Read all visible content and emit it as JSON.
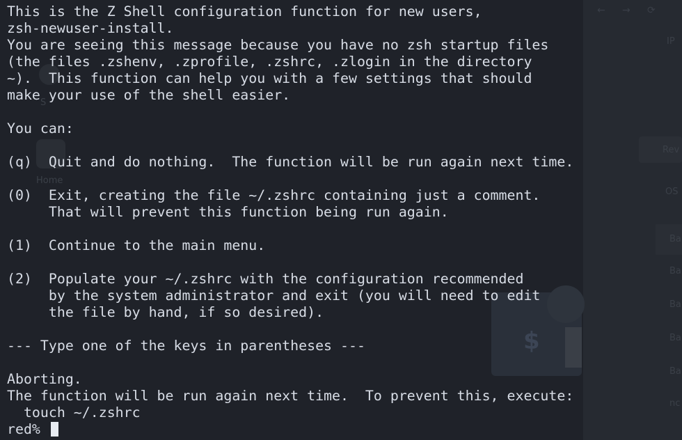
{
  "terminal": {
    "lines": [
      "This is the Z Shell configuration function for new users,",
      "zsh-newuser-install.",
      "You are seeing this message because you have no zsh startup files",
      "(the files .zshenv, .zprofile, .zshrc, .zlogin in the directory",
      "~).  This function can help you with a few settings that should",
      "make your use of the shell easier.",
      "",
      "You can:",
      "",
      "(q)  Quit and do nothing.  The function will be run again next time.",
      "",
      "(0)  Exit, creating the file ~/.zshrc containing just a comment.",
      "     That will prevent this function being run again.",
      "",
      "(1)  Continue to the main menu.",
      "",
      "(2)  Populate your ~/.zshrc with the configuration recommended",
      "     by the system administrator and exit (you will need to edit",
      "     the file by hand, if so desired).",
      "",
      "--- Type one of the keys in parentheses ---",
      "",
      "Aborting.",
      "The function will be run again next time.  To prevent this, execute:",
      "  touch ~/.zshrc"
    ],
    "prompt": "red% "
  },
  "background": {
    "nav_back": "←",
    "nav_forward": "→",
    "nav_reload": "⟳",
    "faint_labels": [
      "IP",
      "Rev",
      "OS",
      "Ba",
      "Ba",
      "Ba",
      "Ba",
      "Ba",
      "nc",
      "Home",
      "S"
    ],
    "glyph": "$"
  },
  "colors": {
    "background": "#1f2229",
    "text": "#d8dde6",
    "cursor": "#e8ecf2"
  }
}
